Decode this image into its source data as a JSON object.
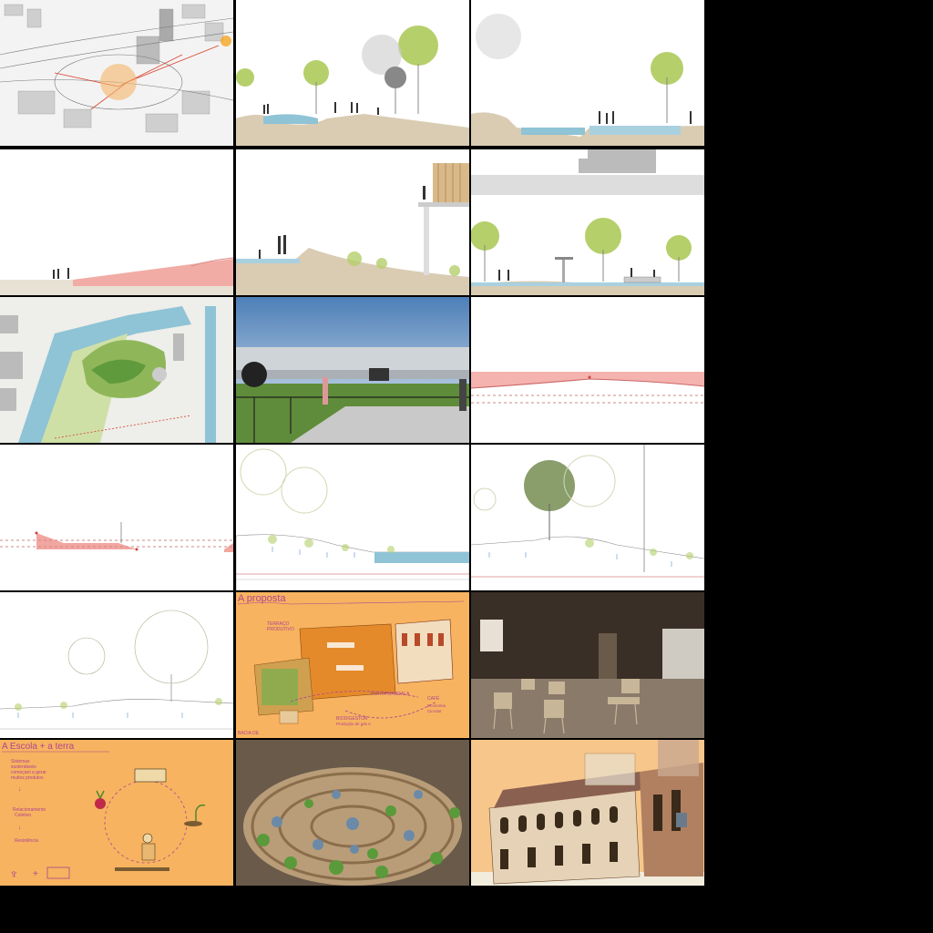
{
  "tiles": {
    "r5c2": {
      "title": "A proposta",
      "label_terrace": "TERRAÇO",
      "label_terrace2": "PRODUTIVO",
      "label_horta": "HORTA MANDALA",
      "label_cafe": "CAFÉ",
      "label_econ1": "Economia",
      "label_econ2": "Circular",
      "label_bio": "BIODIGESTOR",
      "label_bio2": "Produção de gás e",
      "label_bacia": "BACIA DE"
    },
    "r6c1": {
      "title": "A Escola + a terra",
      "text1_l1": "Sistemas",
      "text1_l2": "sustentáveis",
      "text1_l3": "começam a gerar",
      "text1_l4": "muitos produtos",
      "text2_l1": "Relacionamento",
      "text2_l2": "Coletivo",
      "text3": "Resistência",
      "plus": "+"
    }
  },
  "colors": {
    "orange_bg": "#f7b360",
    "purple": "#b0458f",
    "tree_green": "#b5cf6b",
    "water": "#8fc3d6",
    "ground": "#d9ccb3",
    "pink_fill": "#f2a6a0"
  }
}
